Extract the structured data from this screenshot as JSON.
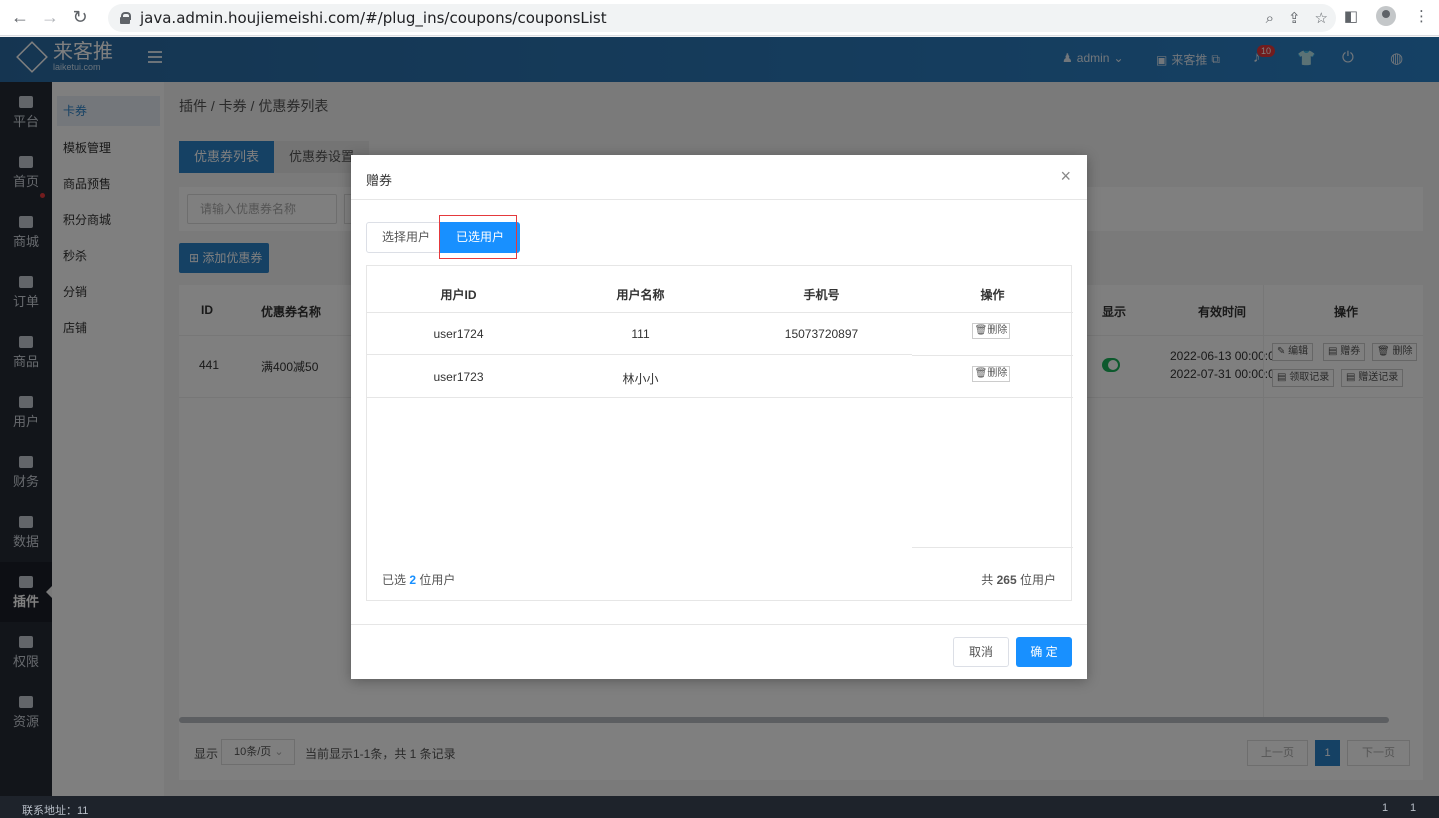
{
  "browser": {
    "url": "java.admin.houjiemeishi.com/#/plug_ins/coupons/couponsList"
  },
  "header": {
    "logo_name": "来客推",
    "logo_sub": "laiketui.com",
    "user": "admin",
    "store": "来客推",
    "notification_count": "10"
  },
  "rail": {
    "items": [
      {
        "label": "平台",
        "icon": "platform-icon"
      },
      {
        "label": "首页",
        "icon": "home-icon"
      },
      {
        "label": "商城",
        "icon": "mall-icon"
      },
      {
        "label": "订单",
        "icon": "order-icon"
      },
      {
        "label": "商品",
        "icon": "goods-icon"
      },
      {
        "label": "用户",
        "icon": "user-icon"
      },
      {
        "label": "财务",
        "icon": "wallet-icon"
      },
      {
        "label": "数据",
        "icon": "pie-chart-icon"
      },
      {
        "label": "插件",
        "icon": "puzzle-icon"
      },
      {
        "label": "权限",
        "icon": "shield-icon"
      },
      {
        "label": "资源",
        "icon": "image-icon"
      }
    ]
  },
  "submenu": {
    "items": [
      "卡券",
      "模板管理",
      "商品预售",
      "积分商城",
      "秒杀",
      "分销",
      "店铺"
    ]
  },
  "main": {
    "breadcrumb": "插件 / 卡券 / 优惠券列表",
    "tab_list": "优惠券列表",
    "tab_settings": "优惠券设置",
    "search_placeholder": "请输入优惠券名称",
    "add_button": "添加优惠券",
    "table": {
      "headers": {
        "id": "ID",
        "name": "优惠券名称",
        "show": "显示",
        "valid_time": "有效时间",
        "ops": "操作"
      },
      "row": {
        "id": "441",
        "name": "满400减50",
        "start": "2022-06-13 00:00:0",
        "end": "2022-07-31 00:00:0"
      },
      "ops": {
        "edit": "编辑",
        "gift": "赠券",
        "delete": "删除",
        "receive_log": "领取记录",
        "gift_log": "赠送记录"
      }
    },
    "pager": {
      "show_label": "显示",
      "page_size": "10条/页",
      "summary": "当前显示1-1条，共 1 条记录",
      "prev": "上一页",
      "current": "1",
      "next": "下一页"
    }
  },
  "status_bar": {
    "left": "联系地址：11",
    "right1": "1",
    "right2": "1"
  },
  "modal": {
    "title": "赠券",
    "close": "×",
    "seg_select": "选择用户",
    "seg_selected": "已选用户",
    "headers": {
      "user_id": "用户ID",
      "user_name": "用户名称",
      "phone": "手机号",
      "op": "操作"
    },
    "rows": [
      {
        "user_id": "user1724",
        "user_name": "111",
        "phone": "15073720897",
        "op": "删除"
      },
      {
        "user_id": "user1723",
        "user_name": "林小小",
        "phone": "",
        "op": "删除"
      }
    ],
    "footer_selected_prefix": "已选",
    "footer_selected_count": "2",
    "footer_selected_suffix": "位用户",
    "footer_total_prefix": "共",
    "footer_total_count": "265",
    "footer_total_suffix": "位用户",
    "cancel": "取消",
    "ok": "确 定"
  }
}
